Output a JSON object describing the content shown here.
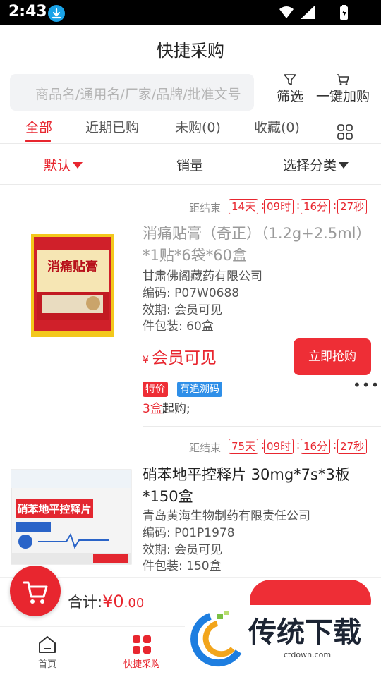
{
  "status_bar": {
    "time": "2:43"
  },
  "header": {
    "title": "快捷采购"
  },
  "search": {
    "placeholder": "商品名/通用名/厂家/品牌/批准文号"
  },
  "toolbar": {
    "filter_label": "筛选",
    "cart_label": "一键加购"
  },
  "tabs": [
    {
      "label": "全部",
      "active": true
    },
    {
      "label": "近期已购",
      "active": false
    },
    {
      "label": "未购(0)",
      "active": false
    },
    {
      "label": "收藏(0)",
      "active": false
    }
  ],
  "sort": [
    {
      "label": "默认",
      "active": true
    },
    {
      "label": "销量",
      "active": false
    },
    {
      "label": "选择分类",
      "active": false
    }
  ],
  "products": [
    {
      "countdown_label": "距结束",
      "countdown": [
        "14天",
        "09时",
        "16分",
        "27秒"
      ],
      "name": "消痛贴膏（奇正）（1.2g+2.5ml）*1贴*6袋*60盒",
      "manufacturer": "甘肃佛阁藏药有限公司",
      "code": "编码: P07W0688",
      "expiry": "效期: 会员可见",
      "package": "件包装: 60盒",
      "price_symbol": "¥",
      "price_text": "会员可见",
      "buy_label": "立即抢购",
      "tags": [
        "特价",
        "有追溯码"
      ],
      "min_qty_num": "3盒",
      "min_qty_text": "起购;",
      "image_text": "消痛贴膏"
    },
    {
      "countdown_label": "距结束",
      "countdown": [
        "75天",
        "09时",
        "16分",
        "27秒"
      ],
      "name": "硝苯地平控释片 30mg*7s*3板*150盒",
      "manufacturer": "青岛黄海生物制药有限责任公司",
      "code": "编码: P01P1978",
      "expiry": "效期: 会员可见",
      "package": "件包装: 150盒",
      "image_text": "硝苯地平控释片"
    }
  ],
  "cart_bar": {
    "total_label": "合计:",
    "total_symbol": "¥",
    "total_int": "0",
    "total_dec": ".00"
  },
  "nav": [
    {
      "label": "首页",
      "active": false
    },
    {
      "label": "快捷采购",
      "active": true
    }
  ],
  "watermark": {
    "text": "传统下载",
    "sub": "ctdown.com"
  },
  "colors": {
    "accent": "#e8262f",
    "tag_blue": "#2f8fe8"
  },
  "icons": [
    "download-icon",
    "wifi-icon",
    "signal-icon",
    "battery-icon",
    "filter-icon",
    "cart-icon",
    "grid-icon",
    "home-icon",
    "quick-buy-icon",
    "more-icon"
  ]
}
